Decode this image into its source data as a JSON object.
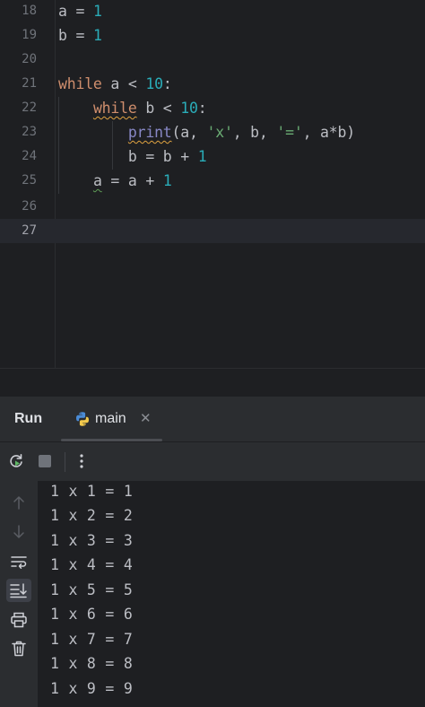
{
  "editor": {
    "lines": [
      {
        "number": "18",
        "code": "a = 1"
      },
      {
        "number": "19",
        "code": "b = 1"
      },
      {
        "number": "20",
        "code": ""
      },
      {
        "number": "21",
        "code": "while a < 10:"
      },
      {
        "number": "22",
        "code": "while b < 10:"
      },
      {
        "number": "23",
        "code": "print(a, 'x', b, '=', a*b)"
      },
      {
        "number": "24",
        "code": "b = b + 1"
      },
      {
        "number": "25",
        "code": "a = a + 1"
      },
      {
        "number": "26",
        "code": ""
      },
      {
        "number": "27",
        "code": ""
      }
    ],
    "current_line": "27",
    "colors": {
      "keyword": "#cf8e6d",
      "number": "#2aacb8",
      "string": "#6aab73",
      "builtin": "#8888c6",
      "warning_underline": "#e0a341"
    }
  },
  "run": {
    "title": "Run",
    "tab": {
      "label": "main",
      "icon": "python-icon",
      "close_icon": "close-icon"
    },
    "toolbar": {
      "rerun_icon": "rerun-icon",
      "stop_icon": "stop-icon",
      "more_icon": "more-vertical-icon"
    },
    "side_icons": [
      "arrow-up-icon",
      "arrow-down-icon",
      "soft-wrap-icon",
      "scroll-to-end-icon",
      "print-icon",
      "trash-icon"
    ],
    "output": [
      "1 x 1 = 1",
      "1 x 2 = 2",
      "1 x 3 = 3",
      "1 x 4 = 4",
      "1 x 5 = 5",
      "1 x 6 = 6",
      "1 x 7 = 7",
      "1 x 8 = 8",
      "1 x 9 = 9"
    ]
  }
}
